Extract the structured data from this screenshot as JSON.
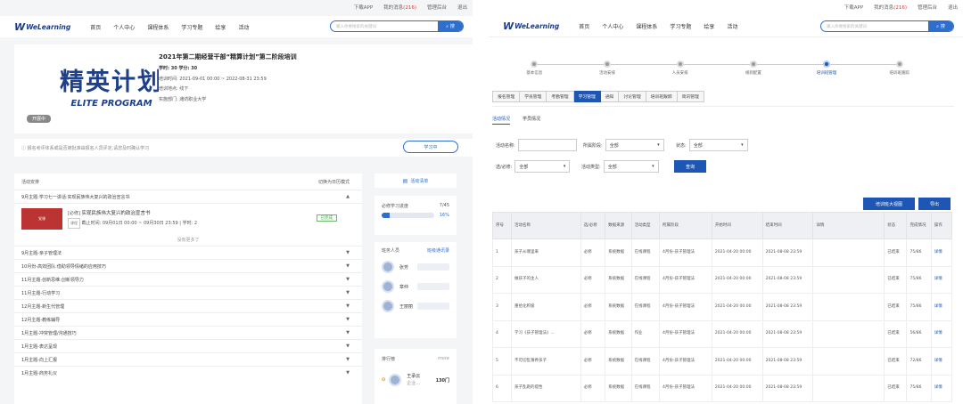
{
  "topbar": {
    "download": "下载APP",
    "messages": "我的消息",
    "msg_count": "(216)",
    "admin": "管理后台",
    "logout": "退出"
  },
  "nav": {
    "logo_text": "WeLearning",
    "items": [
      "首页",
      "个人中心",
      "课程体系",
      "学习专题",
      "绘享",
      "活动"
    ],
    "search_placeholder": "输入你要搜索的关键词",
    "search_btn": "搜"
  },
  "left": {
    "banner": {
      "cn": "精英计划",
      "en": "ELITE PROGRAM",
      "status": "开展中"
    },
    "info": {
      "title": "2021年第二期经营干部“精算计划”第二阶段培训",
      "credits": "学时: 30  学分: 30",
      "time_label": "培训时间:",
      "time": "2021-09-01 00:00 ~ 2022-08-31 23:59",
      "place_label": "培训地点:",
      "place": "线下",
      "org_label": "实施部门:",
      "org": "潍坊职业大学"
    },
    "tip": "报名考评体系或是否被批准由报名人员评定,请您及时确认学习",
    "study_btn": "学习中",
    "catalog": {
      "header": "活动安排",
      "switch": "切换为日历模式",
      "r1": "9月主题:学习七一讲话:实现民族伟大复兴的政治宣言书",
      "course": {
        "thumb": "党课",
        "tag": "[必修]",
        "title": "实现民族伟大复兴的政治宣言书",
        "type": "课程",
        "deadline": "截止时间: 09月01日 00:00 ~ 09月30日 23:59",
        "hours": "学时: 2",
        "status": "已完成"
      },
      "nomore": "没有更多了",
      "rows": [
        "9月主题-亲子管理法",
        "10月份-高效团队:借助领导情绪的应用技巧",
        "11月主题-创新思维:创新领导力",
        "11月主题-行动学习",
        "12月主题-新生代管理",
        "12月主题-教练辅导",
        "1月主题-冲突管理/沟通技巧",
        "1月主题-表达呈现",
        "1月主题-向上汇报",
        "1月主题-商务礼仪"
      ]
    },
    "side": {
      "plan": "活动清单",
      "progress_label": "必修学习进度",
      "progress_count": "7/45",
      "progress_pct": "16%",
      "progress_value": 0.16,
      "staff_label": "班务人员",
      "staff_more": "班级通讯录",
      "staff": [
        "张芳",
        "章仲",
        "王丽丽"
      ],
      "rank_label": "排行榜",
      "rank_more": "more",
      "rank_name": "王承云",
      "rank_org": "企业...",
      "rank_score": "130门"
    }
  },
  "right": {
    "steps": [
      "基本信息",
      "活动安排",
      "人员安排",
      "规则配置",
      "培训班管理",
      "培训班跟踪"
    ],
    "tabs": [
      "报名管理",
      "学员管理",
      "考勤管理",
      "学习管理",
      "通知",
      "讨论管理",
      "培训班跟踪",
      "简讯管理"
    ],
    "subtabs": [
      "活动情况",
      "学员情况"
    ],
    "filters": {
      "name_label": "活动名称:",
      "stage_label": "所属阶段:",
      "stage_val": "全部",
      "status_label": "状态:",
      "status_val": "全部",
      "req_label": "选/必修:",
      "req_val": "全部",
      "type_label": "活动类型:",
      "type_val": "全部",
      "query": "查询"
    },
    "actions": {
      "all": "培训班大视图",
      "export": "导出"
    },
    "table": {
      "headers": [
        "序号",
        "活动名称",
        "选/必修",
        "数据来源",
        "活动类型",
        "所属阶段",
        "开始时间",
        "结束时间",
        "详情",
        "状态",
        "完成情况",
        "操作"
      ],
      "rows": [
        [
          "1",
          "孩子从哪里来",
          "必修",
          "系统数据",
          "在线课程",
          "4月份-孩子管理法",
          "2021-04-20 00:00",
          "2021-08-08 23:59",
          "",
          "已结束",
          "75/86",
          "详情"
        ],
        [
          "2",
          "做孩子的主人",
          "必修",
          "系统数据",
          "在线课程",
          "4月份-孩子管理法",
          "2021-04-20 00:00",
          "2021-08-08 23:59",
          "",
          "已结束",
          "75/86",
          "详情"
        ],
        [
          "3",
          "重拾化积极",
          "必修",
          "系统数据",
          "在线课程",
          "4月份-孩子管理法",
          "2021-04-20 00:00",
          "2021-08-08 23:59",
          "",
          "已结束",
          "75/86",
          "详情"
        ],
        [
          "4",
          "学习《孩子管理法》...",
          "必修",
          "系统数据",
          "作业",
          "4月份-孩子管理法",
          "2021-04-20 00:00",
          "2021-08-08 23:59",
          "",
          "已结束",
          "56/86",
          "详情"
        ],
        [
          "5",
          "不可切乱猜养孩子",
          "必修",
          "系统数据",
          "在线课程",
          "4月份-孩子管理法",
          "2021-04-20 00:00",
          "2021-08-08 23:59",
          "",
          "已结束",
          "72/86",
          "详情"
        ],
        [
          "6",
          "孩子乱跑的提性",
          "必修",
          "系统数据",
          "在线课程",
          "4月份-孩子管理法",
          "2021-04-20 00:00",
          "2021-08-08 23:59",
          "",
          "已结束",
          "75/86",
          "详情"
        ]
      ]
    }
  }
}
